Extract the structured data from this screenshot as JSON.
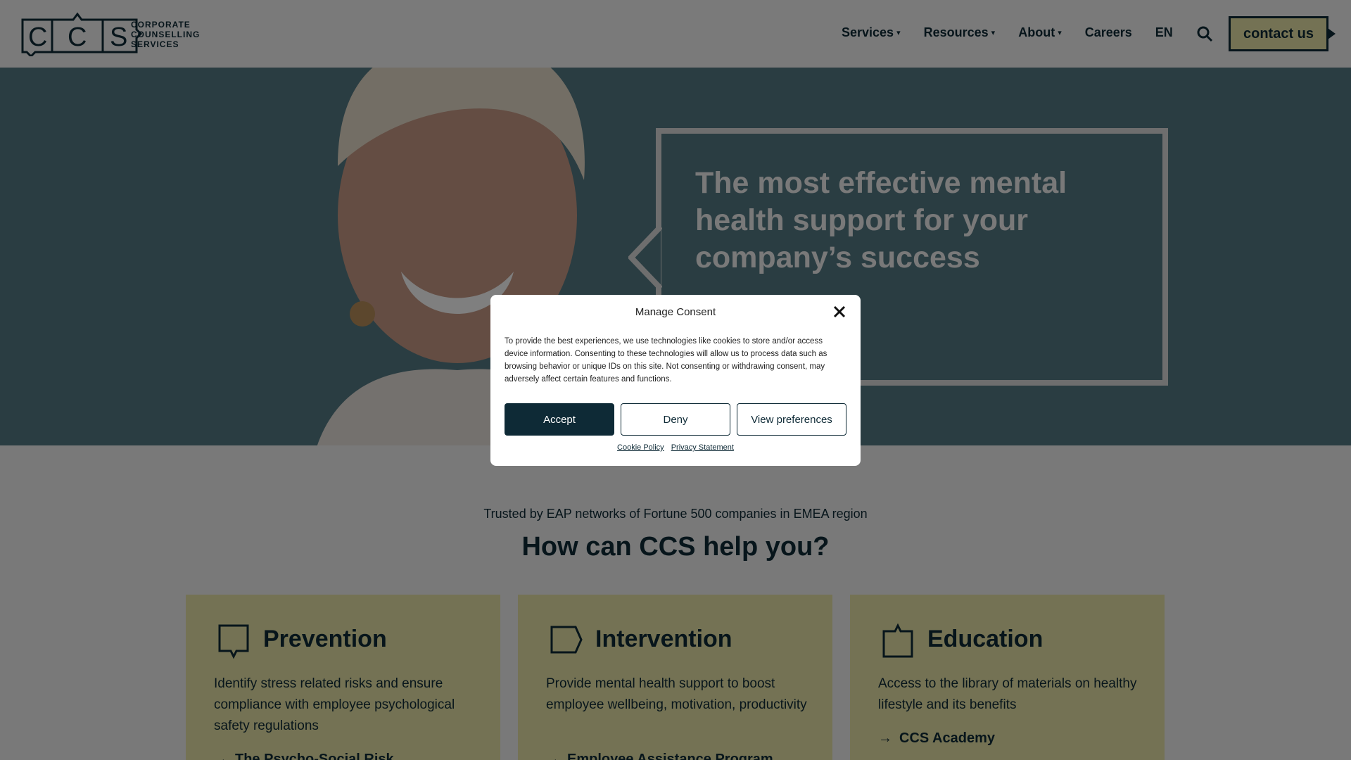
{
  "header": {
    "logo_letters": "CCS",
    "logo_text": [
      "CORPORATE",
      "COUNSELLING",
      "SERVICES"
    ],
    "nav": [
      {
        "label": "Services",
        "has_dropdown": true
      },
      {
        "label": "Resources",
        "has_dropdown": true
      },
      {
        "label": "About",
        "has_dropdown": true
      },
      {
        "label": "Careers",
        "has_dropdown": false
      },
      {
        "label": "EN",
        "has_dropdown": false
      }
    ],
    "search_icon": "search-icon",
    "contact_label": "contact us"
  },
  "hero": {
    "headline": "The most effective mental health support for your company’s success"
  },
  "section": {
    "trusted": "Trusted by EAP networks of Fortune 500 companies in EMEA region",
    "title": "How can CCS help you?"
  },
  "cards": [
    {
      "title": "Prevention",
      "icon": "speech-bubble-down-icon",
      "desc": "Identify stress related risks and ensure compliance with employee psychological safety regulations",
      "link": "The Psycho-Social Risk"
    },
    {
      "title": "Intervention",
      "icon": "speech-bubble-right-icon",
      "desc": "Provide mental health support to boost employee wellbeing, motivation, productivity",
      "link": "Employee Assistance Program"
    },
    {
      "title": "Education",
      "icon": "speech-bubble-up-icon",
      "desc": "Access to the library of materials on healthy lifestyle and its benefits",
      "link": "CCS Academy"
    }
  ],
  "consent": {
    "title": "Manage Consent",
    "text": "To provide the best experiences, we use technologies like cookies to store and/or access device information. Consenting to these technologies will allow us to process data such as browsing behavior or unique IDs on this site. Not consenting or withdrawing consent, may adversely affect certain features and functions.",
    "accept": "Accept",
    "deny": "Deny",
    "preferences": "View preferences",
    "cookie_policy": "Cookie Policy",
    "privacy": "Privacy Statement"
  },
  "colors": {
    "brand_dark": "#0e2a36",
    "accent_yellow": "#e9e4a8",
    "hero_bg": "#557a84"
  }
}
